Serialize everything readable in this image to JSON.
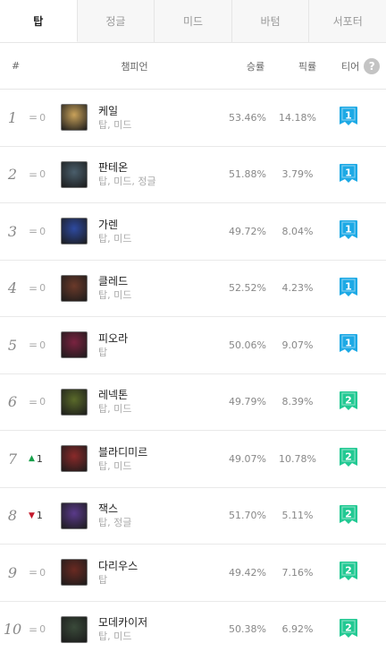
{
  "tabs": [
    {
      "label": "탑",
      "active": true
    },
    {
      "label": "정글",
      "active": false
    },
    {
      "label": "미드",
      "active": false
    },
    {
      "label": "바텀",
      "active": false
    },
    {
      "label": "서포터",
      "active": false
    }
  ],
  "header": {
    "num": "#",
    "champion": "챔피언",
    "winrate": "승률",
    "pickrate": "픽률",
    "tier": "티어",
    "help": "?"
  },
  "rows": [
    {
      "rank": "1",
      "change_dir": "none",
      "change": "0",
      "name": "케일",
      "pos": "탑, 미드",
      "win": "53.46%",
      "pick": "14.18%",
      "tier": "1",
      "avatar_color": "#c9a25a"
    },
    {
      "rank": "2",
      "change_dir": "none",
      "change": "0",
      "name": "판테온",
      "pos": "탑, 미드, 정글",
      "win": "51.88%",
      "pick": "3.79%",
      "tier": "1",
      "avatar_color": "#4a5e6b"
    },
    {
      "rank": "3",
      "change_dir": "none",
      "change": "0",
      "name": "가렌",
      "pos": "탑, 미드",
      "win": "49.72%",
      "pick": "8.04%",
      "tier": "1",
      "avatar_color": "#2e4aa0"
    },
    {
      "rank": "4",
      "change_dir": "none",
      "change": "0",
      "name": "클레드",
      "pos": "탑, 미드",
      "win": "52.52%",
      "pick": "4.23%",
      "tier": "1",
      "avatar_color": "#6b3a2a"
    },
    {
      "rank": "5",
      "change_dir": "none",
      "change": "0",
      "name": "피오라",
      "pos": "탑",
      "win": "50.06%",
      "pick": "9.07%",
      "tier": "1",
      "avatar_color": "#7a2340"
    },
    {
      "rank": "6",
      "change_dir": "none",
      "change": "0",
      "name": "레넥톤",
      "pos": "탑, 미드",
      "win": "49.79%",
      "pick": "8.39%",
      "tier": "2",
      "avatar_color": "#5a6a2a"
    },
    {
      "rank": "7",
      "change_dir": "up",
      "change": "1",
      "name": "블라디미르",
      "pos": "탑, 미드",
      "win": "49.07%",
      "pick": "10.78%",
      "tier": "2",
      "avatar_color": "#8a2a2a"
    },
    {
      "rank": "8",
      "change_dir": "down",
      "change": "1",
      "name": "잭스",
      "pos": "탑, 정글",
      "win": "51.70%",
      "pick": "5.11%",
      "tier": "2",
      "avatar_color": "#5a3a8a"
    },
    {
      "rank": "9",
      "change_dir": "none",
      "change": "0",
      "name": "다리우스",
      "pos": "탑",
      "win": "49.42%",
      "pick": "7.16%",
      "tier": "2",
      "avatar_color": "#6a2a22"
    },
    {
      "rank": "10",
      "change_dir": "none",
      "change": "0",
      "name": "모데카이저",
      "pos": "탑, 미드",
      "win": "50.38%",
      "pick": "6.92%",
      "tier": "2",
      "avatar_color": "#3a4a3a"
    }
  ],
  "colors": {
    "tier1": "#1ca9e5",
    "tier2": "#22c993",
    "up": "#16a04a",
    "down": "#c4192c"
  }
}
